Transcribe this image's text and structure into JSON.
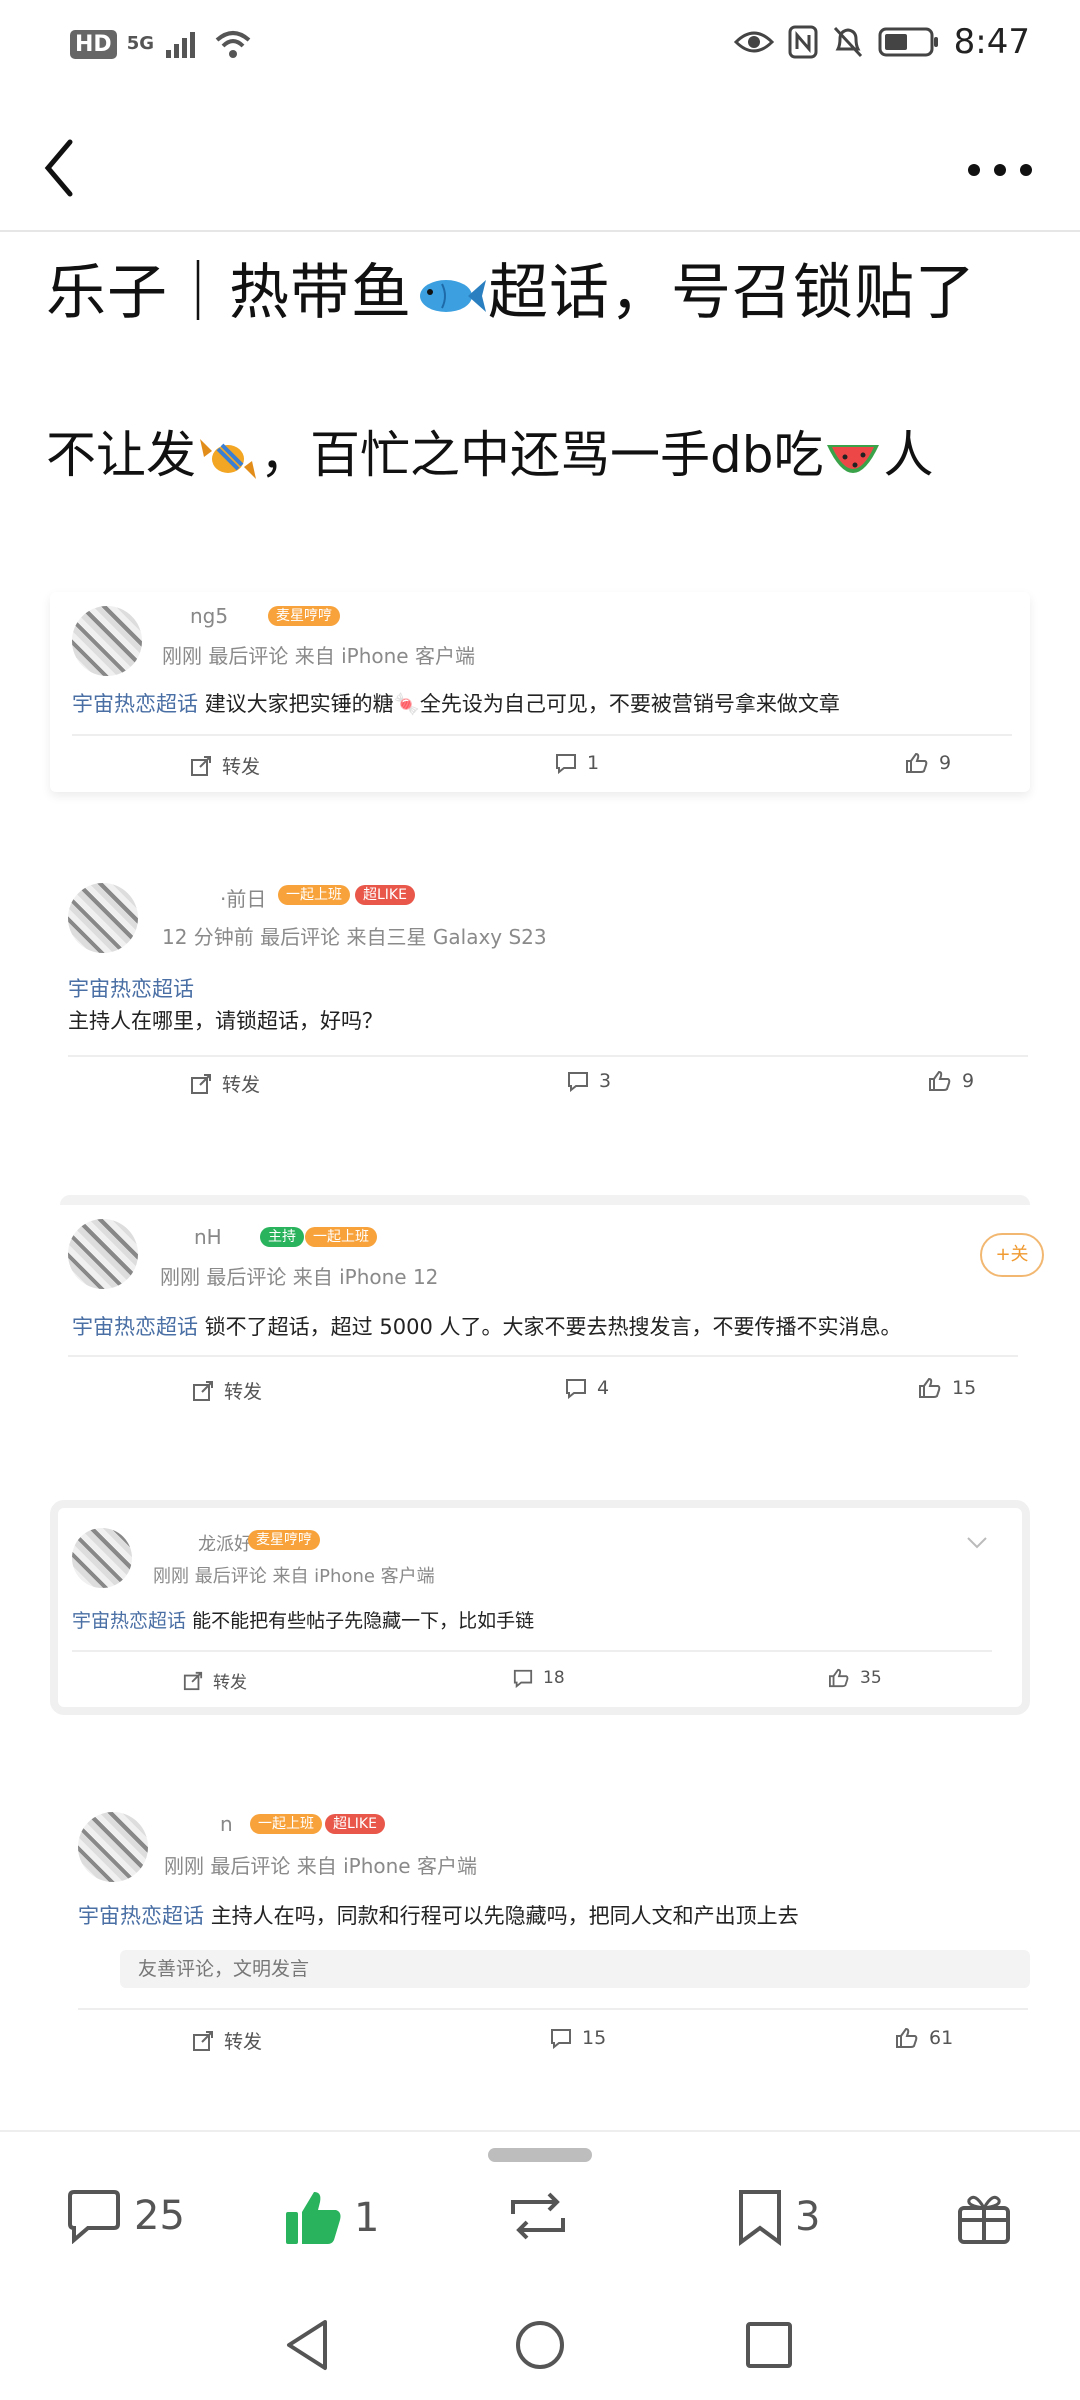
{
  "status_bar": {
    "hd": "HD",
    "network": "5G",
    "time": "8:47"
  },
  "post": {
    "title": "乐子｜热带鱼🐟超话，号召锁贴了",
    "title_before_emoji": "乐子｜热带鱼",
    "title_after_emoji": "超话，号召锁贴了",
    "subtitle_part1": "不让发",
    "subtitle_part2": "，百忙之中还骂一手db吃",
    "subtitle_part3": "人"
  },
  "comments": [
    {
      "username": "ng5",
      "badges": [
        "麦星哼哼"
      ],
      "meta": "刚刚  最后评论  来自 iPhone 客户端",
      "tag": "宇宙热恋超话",
      "text": "建议大家把实锤的糖🍬全先设为自己可见，不要被营销号拿来做文章",
      "repost": "转发",
      "comments": "1",
      "likes": "9"
    },
    {
      "username": "·前日",
      "badges": [
        "一起上班",
        "超LIKE"
      ],
      "meta": "12 分钟前  最后评论  来自三星 Galaxy S23",
      "tag": "宇宙热恋超话",
      "text": "主持人在哪里，请锁超话，好吗？",
      "repost": "转发",
      "comments": "3",
      "likes": "9"
    },
    {
      "username": "nH",
      "badges": [
        "主持",
        "一起上班"
      ],
      "meta": "刚刚  最后评论  来自 iPhone 12",
      "tag": "宇宙热恋超话",
      "text": "锁不了超话，超过 5000 人了。大家不要去热搜发言，不要传播不实消息。",
      "follow": "+关",
      "repost": "转发",
      "comments": "4",
      "likes": "15"
    },
    {
      "username": "龙派好",
      "badges": [
        "麦星哼哼"
      ],
      "meta": "刚刚  最后评论  来自 iPhone 客户端",
      "tag": "宇宙热恋超话",
      "text": "能不能把有些帖子先隐藏一下，比如手链",
      "repost": "转发",
      "comments": "18",
      "likes": "35"
    },
    {
      "username": "n",
      "badges": [
        "一起上班",
        "超LIKE"
      ],
      "meta": "刚刚  最后评论  来自 iPhone 客户端",
      "tag": "宇宙热恋超话",
      "text": "主持人在吗，同款和行程可以先隐藏吗，把同人文和产出顶上去",
      "reply_placeholder": "友善评论，文明发言",
      "repost": "转发",
      "comments": "15",
      "likes": "61"
    }
  ],
  "bottom_bar": {
    "comments_count": "25",
    "likes_count": "1",
    "favorites_count": "3"
  },
  "colors": {
    "tag_blue": "#4a6fa5",
    "like_green": "#29b35d",
    "badge_orange": "#f7a23a"
  }
}
